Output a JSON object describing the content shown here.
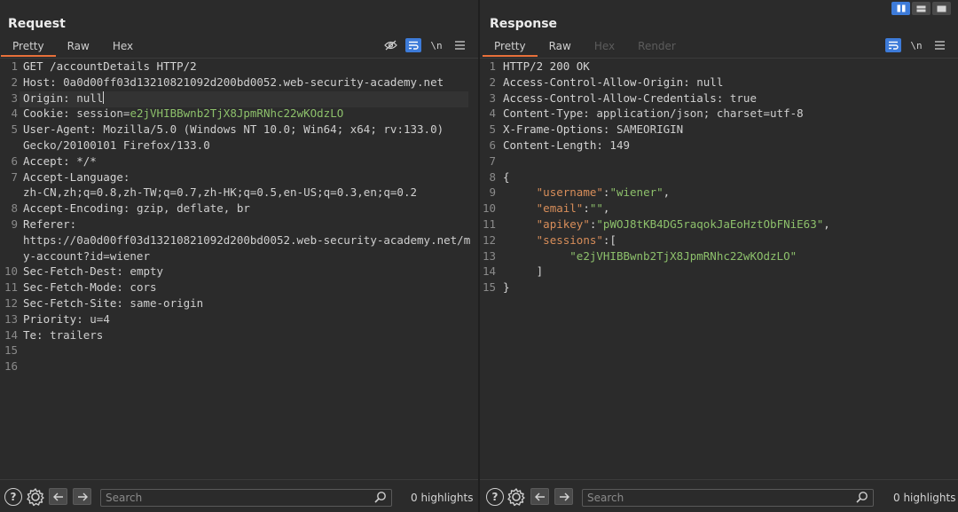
{
  "request": {
    "title": "Request",
    "tabs": [
      "Pretty",
      "Raw",
      "Hex"
    ],
    "active_tab": "Pretty",
    "tools": {
      "newline": "\\n"
    },
    "lines": [
      {
        "n": "1",
        "parts": [
          [
            "hdr",
            "GET /accountDetails HTTP/2"
          ]
        ]
      },
      {
        "n": "2",
        "parts": [
          [
            "hdr",
            "Host: "
          ],
          [
            "val",
            "0a0d00ff03d13210821092d200bd0052.web-security-academy.net"
          ]
        ]
      },
      {
        "n": "3",
        "parts": [
          [
            "hdr",
            "Origin: "
          ],
          [
            "val",
            "null"
          ]
        ],
        "cursor": true,
        "highlight": true
      },
      {
        "n": "4",
        "parts": [
          [
            "hdr",
            "Cookie: "
          ],
          [
            "val",
            "session="
          ],
          [
            "green",
            "e2jVHIBBwnb2TjX8JpmRNhc22wKOdzLO"
          ]
        ]
      },
      {
        "n": "5",
        "parts": [
          [
            "hdr",
            "User-Agent: "
          ],
          [
            "val",
            "Mozilla/5.0 (Windows NT 10.0; Win64; x64; rv:133.0)"
          ]
        ]
      },
      {
        "n": "",
        "parts": [
          [
            "val",
            "Gecko/20100101 Firefox/133.0"
          ]
        ]
      },
      {
        "n": "6",
        "parts": [
          [
            "hdr",
            "Accept: "
          ],
          [
            "val",
            "*/*"
          ]
        ]
      },
      {
        "n": "7",
        "parts": [
          [
            "hdr",
            "Accept-Language: "
          ]
        ]
      },
      {
        "n": "",
        "parts": [
          [
            "val",
            "zh-CN,zh;q=0.8,zh-TW;q=0.7,zh-HK;q=0.5,en-US;q=0.3,en;q=0.2"
          ]
        ]
      },
      {
        "n": "8",
        "parts": [
          [
            "hdr",
            "Accept-Encoding: "
          ],
          [
            "val",
            "gzip, deflate, br"
          ]
        ]
      },
      {
        "n": "9",
        "parts": [
          [
            "hdr",
            "Referer: "
          ]
        ]
      },
      {
        "n": "",
        "parts": [
          [
            "val",
            "https://0a0d00ff03d13210821092d200bd0052.web-security-academy.net/m"
          ]
        ]
      },
      {
        "n": "",
        "parts": [
          [
            "val",
            "y-account?id=wiener"
          ]
        ]
      },
      {
        "n": "10",
        "parts": [
          [
            "hdr",
            "Sec-Fetch-Dest: "
          ],
          [
            "val",
            "empty"
          ]
        ]
      },
      {
        "n": "11",
        "parts": [
          [
            "hdr",
            "Sec-Fetch-Mode: "
          ],
          [
            "val",
            "cors"
          ]
        ]
      },
      {
        "n": "12",
        "parts": [
          [
            "hdr",
            "Sec-Fetch-Site: "
          ],
          [
            "val",
            "same-origin"
          ]
        ]
      },
      {
        "n": "13",
        "parts": [
          [
            "hdr",
            "Priority: "
          ],
          [
            "val",
            "u=4"
          ]
        ]
      },
      {
        "n": "14",
        "parts": [
          [
            "hdr",
            "Te: "
          ],
          [
            "val",
            "trailers"
          ]
        ]
      },
      {
        "n": "15",
        "parts": []
      },
      {
        "n": "16",
        "parts": []
      }
    ],
    "search_placeholder": "Search",
    "highlights": "0 highlights"
  },
  "response": {
    "title": "Response",
    "tabs": [
      "Pretty",
      "Raw",
      "Hex",
      "Render"
    ],
    "active_tab": "Pretty",
    "disabled_tabs": [
      "Hex",
      "Render"
    ],
    "tools": {
      "newline": "\\n"
    },
    "lines": [
      {
        "n": "1",
        "parts": [
          [
            "hdr",
            "HTTP/2 200 OK"
          ]
        ]
      },
      {
        "n": "2",
        "parts": [
          [
            "hdr",
            "Access-Control-Allow-Origin: "
          ],
          [
            "val",
            "null"
          ]
        ]
      },
      {
        "n": "3",
        "parts": [
          [
            "hdr",
            "Access-Control-Allow-Credentials: "
          ],
          [
            "val",
            "true"
          ]
        ]
      },
      {
        "n": "4",
        "parts": [
          [
            "hdr",
            "Content-Type: "
          ],
          [
            "val",
            "application/json; charset=utf-8"
          ]
        ]
      },
      {
        "n": "5",
        "parts": [
          [
            "hdr",
            "X-Frame-Options: "
          ],
          [
            "val",
            "SAMEORIGIN"
          ]
        ]
      },
      {
        "n": "6",
        "parts": [
          [
            "hdr",
            "Content-Length: "
          ],
          [
            "val",
            "149"
          ]
        ]
      },
      {
        "n": "7",
        "parts": []
      },
      {
        "n": "8",
        "parts": [
          [
            "punc",
            "{"
          ]
        ]
      },
      {
        "n": "9",
        "parts": [
          [
            "punc",
            "     "
          ],
          [
            "key",
            "\"username\""
          ],
          [
            "punc",
            ":"
          ],
          [
            "str",
            "\"wiener\""
          ],
          [
            "punc",
            ","
          ]
        ]
      },
      {
        "n": "10",
        "parts": [
          [
            "punc",
            "     "
          ],
          [
            "key",
            "\"email\""
          ],
          [
            "punc",
            ":"
          ],
          [
            "str",
            "\"\""
          ],
          [
            "punc",
            ","
          ]
        ]
      },
      {
        "n": "11",
        "parts": [
          [
            "punc",
            "     "
          ],
          [
            "key",
            "\"apikey\""
          ],
          [
            "punc",
            ":"
          ],
          [
            "str",
            "\"pWOJ8tKB4DG5raqokJaEoHztObFNiE63\""
          ],
          [
            "punc",
            ","
          ]
        ]
      },
      {
        "n": "12",
        "parts": [
          [
            "punc",
            "     "
          ],
          [
            "key",
            "\"sessions\""
          ],
          [
            "punc",
            ":["
          ]
        ]
      },
      {
        "n": "13",
        "parts": [
          [
            "punc",
            "          "
          ],
          [
            "str",
            "\"e2jVHIBBwnb2TjX8JpmRNhc22wKOdzLO\""
          ]
        ]
      },
      {
        "n": "14",
        "parts": [
          [
            "punc",
            "     ]"
          ]
        ]
      },
      {
        "n": "15",
        "parts": [
          [
            "punc",
            "}"
          ]
        ]
      }
    ],
    "search_placeholder": "Search",
    "highlights": "0 highlights"
  },
  "colors": {
    "accent": "#e8703a",
    "active_tool": "#3d7bd9",
    "json_key": "#d88e5a",
    "json_string": "#8dc06b"
  }
}
